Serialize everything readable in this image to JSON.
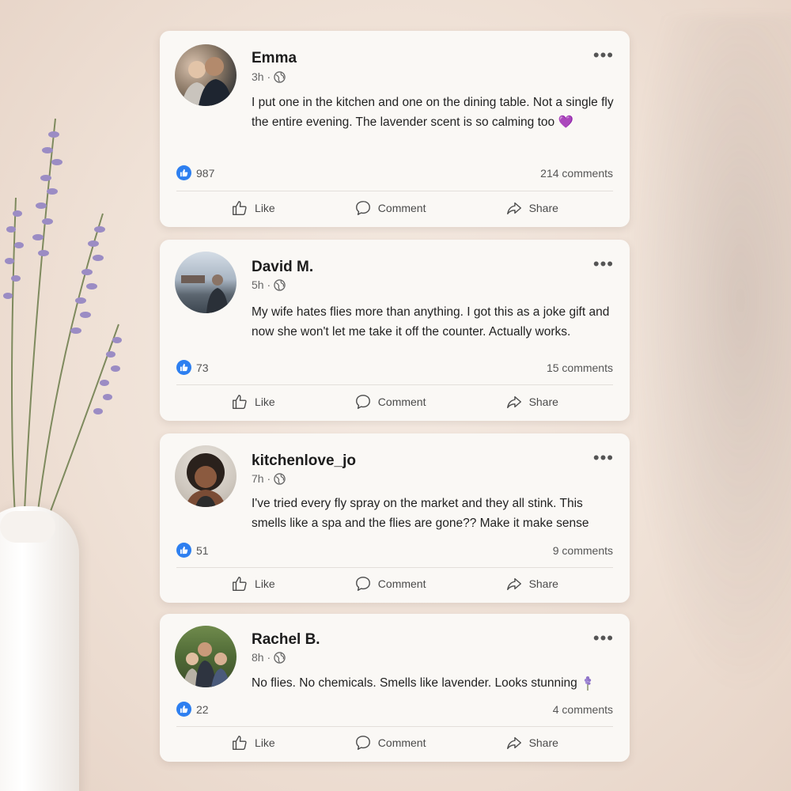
{
  "colors": {
    "like_blue": "#2d7ff0",
    "card_bg": "#faf8f5",
    "background": "#efe1d6"
  },
  "actions": {
    "like": "Like",
    "comment": "Comment",
    "share": "Share"
  },
  "posts": [
    {
      "author": "Emma",
      "time": "3h ·",
      "text": "I put one in the kitchen and one on the dining table. Not a single fly the entire evening. The lavender scent is so calming too 💜",
      "likes": "987",
      "comments": "214 comments"
    },
    {
      "author": "David M.",
      "time": "5h ·",
      "text": "My wife hates flies more than anything. I got this as a joke gift and now she won't let me take it off the counter. Actually works.",
      "likes": "73",
      "comments": "15 comments"
    },
    {
      "author": "kitchenlove_jo",
      "time": "7h ·",
      "text": "I've tried every fly spray on the market and they all stink. This smells like a spa and the flies are gone?? Make it make sense",
      "likes": "51",
      "comments": "9 comments"
    },
    {
      "author": "Rachel B.",
      "time": "8h ·",
      "text": "No flies. No chemicals. Smells like lavender. Looks stunning",
      "likes": "22",
      "comments": "4 comments"
    }
  ]
}
